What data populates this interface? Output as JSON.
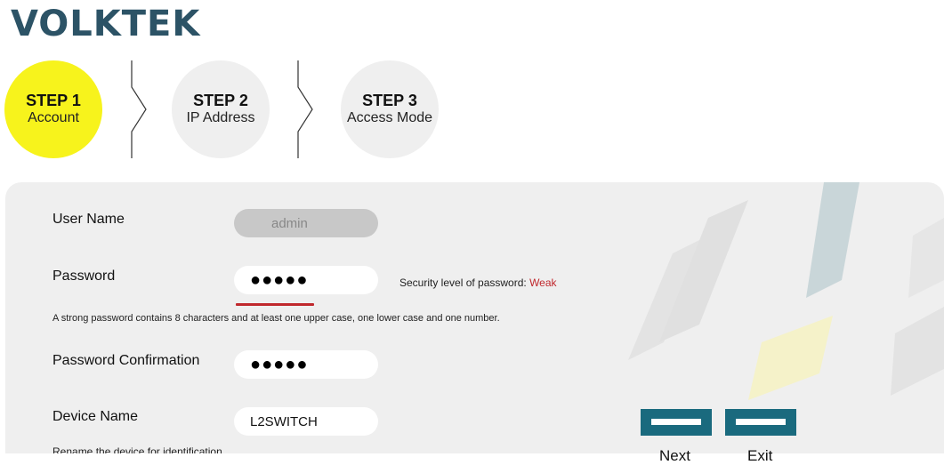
{
  "brand": {
    "logo_text": "VOLKTEK"
  },
  "steps": [
    {
      "number": "STEP 1",
      "label": "Account",
      "active": true
    },
    {
      "number": "STEP 2",
      "label": "IP Address",
      "active": false
    },
    {
      "number": "STEP 3",
      "label": "Access Mode",
      "active": false
    }
  ],
  "form": {
    "username": {
      "label": "User Name",
      "value": "admin",
      "disabled": true
    },
    "password": {
      "label": "Password",
      "masked_value": "●●●●●",
      "security_label": "Security level of password: ",
      "security_level": "Weak",
      "security_color": "#c0282d",
      "hint": "A strong password contains 8 characters and at least one upper case, one lower case and one number."
    },
    "password_confirm": {
      "label": "Password Confirmation",
      "masked_value": "●●●●●"
    },
    "device_name": {
      "label": "Device Name",
      "value": "L2SWITCH",
      "hint": "Rename the device for identification."
    }
  },
  "actions": {
    "next_label": "Next",
    "exit_label": "Exit"
  },
  "colors": {
    "accent": "#1a6a7e",
    "active_step": "#f7f31c",
    "logo": "#2c5366"
  }
}
